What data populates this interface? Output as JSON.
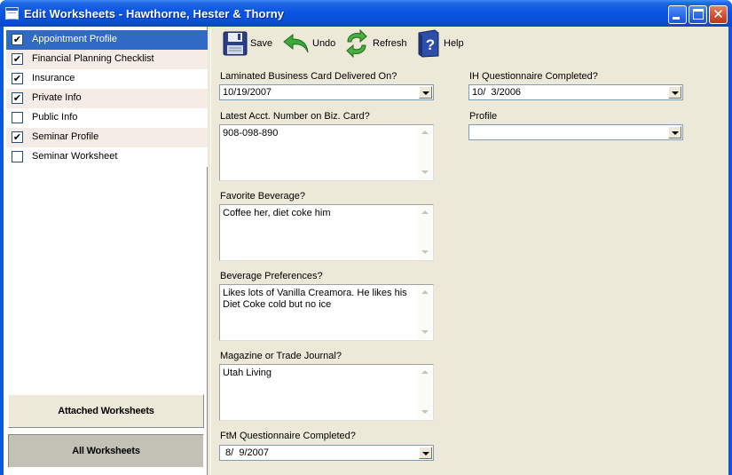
{
  "window": {
    "title": "Edit Worksheets - Hawthorne, Hester & Thorny",
    "controls": {
      "minimize": "minimize",
      "maximize": "maximize",
      "close": "✕"
    }
  },
  "worksheets": {
    "items": [
      {
        "label": "Appointment Profile",
        "checked": true,
        "selected": true
      },
      {
        "label": "Financial Planning Checklist",
        "checked": true,
        "selected": false
      },
      {
        "label": "Insurance",
        "checked": true,
        "selected": false
      },
      {
        "label": "Private Info",
        "checked": true,
        "selected": false
      },
      {
        "label": "Public Info",
        "checked": false,
        "selected": false
      },
      {
        "label": "Seminar Profile",
        "checked": true,
        "selected": false
      },
      {
        "label": "Seminar Worksheet",
        "checked": false,
        "selected": false
      }
    ],
    "attached_button": "Attached Worksheets",
    "all_button": "All Worksheets"
  },
  "toolbar": {
    "save": "Save",
    "undo": "Undo",
    "refresh": "Refresh",
    "help": "Help",
    "icons": {
      "save": "floppy-disk-icon",
      "undo": "undo-arrow-icon",
      "refresh": "refresh-arrows-icon",
      "help": "help-book-icon"
    }
  },
  "form": {
    "card_delivered": {
      "label": "Laminated Business Card Delivered On?",
      "value": "10/19/2007"
    },
    "acct_number": {
      "label": "Latest Acct. Number on Biz. Card?",
      "value": "908-098-890"
    },
    "favorite_beverage": {
      "label": "Favorite Beverage?",
      "value": "Coffee her, diet coke him"
    },
    "beverage_prefs": {
      "label": "Beverage Preferences?",
      "value": "Likes lots of Vanilla Creamora. He likes his Diet Coke cold but no ice"
    },
    "magazine": {
      "label": "Magazine or Trade Journal?",
      "value": "Utah Living"
    },
    "ftm_completed": {
      "label": "FtM Questionnaire Completed?",
      "value": " 8/  9/2007"
    },
    "ih_completed": {
      "label": "IH Questionnaire Completed?",
      "value": "10/  3/2006"
    },
    "profile": {
      "label": "Profile",
      "value": ""
    }
  },
  "colors": {
    "titlebar": "#0955e4",
    "selection": "#316ac5",
    "panel": "#ece9d8",
    "alt_row": "#f6ece6"
  }
}
